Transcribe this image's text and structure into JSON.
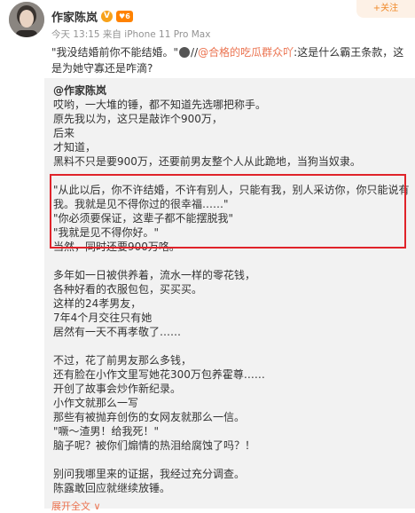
{
  "header": {
    "author": "作家陈岚",
    "level_badge": "6",
    "meta": "今天 13:15 来自 iPhone 11 Pro Max",
    "follow_label": "+关注"
  },
  "post": {
    "text_before": "\"我没结婚前你不能结婚。\"",
    "separator": "//",
    "mention": "@合格的吃瓜群众吖",
    "text_after": ":这是什么霸王条款，这是为她守寡还是咋滴?"
  },
  "repost": {
    "author": "@作家陈岚",
    "lines": [
      "哎哟，一大堆的锤，都不知道先选哪把称手。",
      "原先我以为，这只是敲诈个900万，",
      "后来",
      "才知道，",
      "黑料不只是要900万，还要前男友整个人从此跪地，当狗当奴隶。",
      "",
      "\"从此以后，你不许结婚，不许有别人，只能有我，别人采访你，你只能说有",
      "我。我就是见不得你过的很幸福……\"",
      "\"你必须要保证，这辈子都不能摆脱我\"",
      "\"我就是见不得你好。\"",
      "当然，同时还要900万咯。",
      "",
      "多年如一日被供养着，流水一样的零花钱，",
      "各种好看的衣服包包，买买买。",
      "这样的24孝男友，",
      "7年4个月交往只有她",
      "居然有一天不再孝敬了……",
      "",
      "不过，花了前男友那么多钱，",
      "还有脸在小作文里写她花300万包养霍尊……",
      "开创了故事会炒作新纪录。",
      "小作文就那么一写",
      "那些有被抛弃创伤的女网友就那么一信。",
      "\"噘～渣男！给我死！\"",
      "脑子呢？被你们煽情的热泪给腐蚀了吗？！",
      "",
      "别问我哪里来的证据，我经过充分调查。",
      "陈露敢回应就继续放锤。"
    ]
  },
  "expand_label": "展开全文 ∨"
}
